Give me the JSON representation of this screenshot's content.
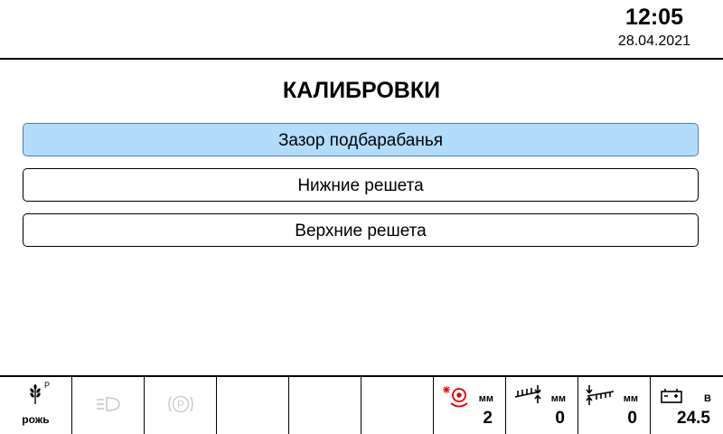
{
  "header": {
    "time": "12:05",
    "date": "28.04.2021"
  },
  "page_title": "КАЛИБРОВКИ",
  "menu": [
    {
      "label": "Зазор подбарабанья",
      "selected": true
    },
    {
      "label": "Нижние решета",
      "selected": false
    },
    {
      "label": "Верхние решета",
      "selected": false
    }
  ],
  "status_bar": {
    "crop": {
      "label": "рожь",
      "superscript": "P"
    },
    "headlight_icon": "headlight-icon",
    "parking_brake_icon": "parking-brake-icon",
    "concave_gap": {
      "unit": "мм",
      "value": "2",
      "icon": "concave-gap-icon",
      "color": "#e00000"
    },
    "lower_sieve": {
      "unit": "мм",
      "value": "0",
      "icon": "lower-sieve-icon"
    },
    "upper_sieve": {
      "unit": "мм",
      "value": "0",
      "icon": "upper-sieve-icon"
    },
    "battery": {
      "unit": "В",
      "value": "24.5",
      "icon": "battery-icon"
    }
  }
}
